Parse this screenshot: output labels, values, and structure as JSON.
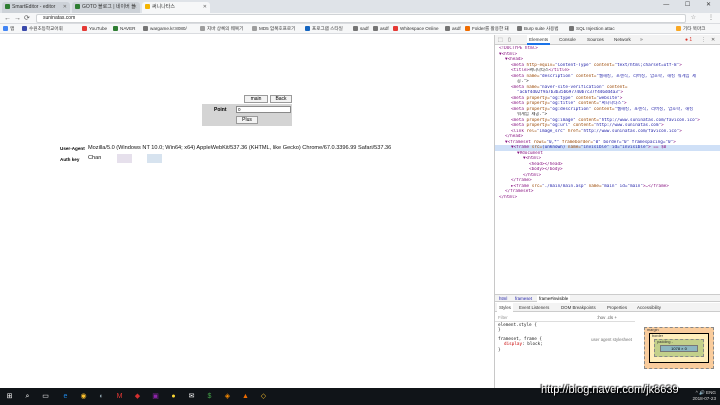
{
  "tabs": [
    {
      "label": "SmartEditor - editor",
      "color": "#2e7d32"
    },
    {
      "label": "GOTO 블로그 | 네이버 블",
      "color": "#2e7d32"
    },
    {
      "label": "써니나타스",
      "color": "#f4b400"
    }
  ],
  "window_controls": "— ☐ ✕",
  "address": {
    "back": "←",
    "forward": "→",
    "reload": "⟳",
    "url": "suninatas.com",
    "star": "☆",
    "menu": "⋮"
  },
  "bookmarks": [
    {
      "label": "앱",
      "color": "#4285f4"
    },
    {
      "label": "수원초등학교어휘",
      "color": "#3949ab"
    },
    {
      "label": "YouTube",
      "color": "#e53935"
    },
    {
      "label": "NAVER",
      "color": "#2e7d32"
    },
    {
      "label": "wargame.kr:8080/",
      "color": "#757575"
    },
    {
      "label": "지바 상록의 웨복기",
      "color": "#9e9e9e"
    },
    {
      "label": "MD5 암복호프로기",
      "color": "#9e9e9e"
    },
    {
      "label": "프로그램 스타일",
      "color": "#1565c0"
    },
    {
      "label": "sadf",
      "color": "#757575"
    },
    {
      "label": "asdf",
      "color": "#757575"
    },
    {
      "label": "Whitespace Online",
      "color": "#e53935"
    },
    {
      "label": "asdf",
      "color": "#757575"
    },
    {
      "label": "Folder를 활용한 돼",
      "color": "#ef6c00"
    },
    {
      "label": "Burp suite 사용법",
      "color": "#757575"
    },
    {
      "label": "SQL Injection attac",
      "color": "#757575"
    },
    {
      "label": "기타 북마크",
      "color": "#f9a825"
    }
  ],
  "page": {
    "main_button": "main",
    "back_button": "Back",
    "point_label": "Point",
    "point_value": "0",
    "plus_button": "Plus",
    "ua_label": "User-Agent",
    "ua_value": "Mozilla/5.0 (Windows NT 10.0; Win64; x64) AppleWebKit/537.36 (KHTML, like Gecko) Chrome/67.0.3396.99 Safari/537.36",
    "authkey_label": "Auth key",
    "authkey_value": "Chan",
    "swatch_colors": [
      "#e6e0ec",
      "#ffffff",
      "#d7e3ef"
    ]
  },
  "devtools": {
    "tabs": [
      "Elements",
      "Console",
      "Sources",
      "Network"
    ],
    "active_tab": "Elements",
    "more": "»",
    "errors": "● 1",
    "settings": "⋮",
    "close": "✕",
    "dom_lines": [
      {
        "i": 0,
        "tag": "<!DOCTYPE html>"
      },
      {
        "i": 0,
        "tag": "▼<html>"
      },
      {
        "i": 1,
        "tag": "▼<head>"
      },
      {
        "i": 2,
        "tag": "<meta",
        "attr": " http-equiv=",
        "val": "\"Content-Type\"",
        "attr2": " content=",
        "val2": "\"text/html;charset=utf-8\"",
        "end": ">"
      },
      {
        "i": 2,
        "tag": "<title>",
        "text": "써니나타스",
        "end": "</title>"
      },
      {
        "i": 2,
        "tag": "<meta",
        "attr": " name=",
        "val": "\"description\"",
        "attr2": " content=",
        "val2": "\"웹해킹, 포렌식, 리버싱, 암호학, 해킹 워게임 제",
        "end": ""
      },
      {
        "i": 3,
        "text": "공.\">"
      },
      {
        "i": 2,
        "tag": "<meta",
        "attr": " name=",
        "val": "\"naver-site-verification\"",
        "attr2": " content=",
        "val2": "",
        "end": ""
      },
      {
        "i": 3,
        "val": "\"ac6f4d02f9a7b3b35b697740b7c37f446dd4a3\"",
        "end": ">"
      },
      {
        "i": 2,
        "tag": "<meta",
        "attr": " property=",
        "val": "\"og:type\"",
        "attr2": " content=",
        "val2": "\"website\"",
        "end": ">"
      },
      {
        "i": 2,
        "tag": "<meta",
        "attr": " property=",
        "val": "\"og:title\"",
        "attr2": " content=",
        "val2": "\"써니나타스\"",
        "end": ">"
      },
      {
        "i": 2,
        "tag": "<meta",
        "attr": " property=",
        "val": "\"og:description\"",
        "attr2": " content=",
        "val2": "\"웹해킹, 포렌식, 리버싱, 암호학, 해킹",
        "end": ""
      },
      {
        "i": 3,
        "text": "워게임 제공.\">"
      },
      {
        "i": 2,
        "tag": "<meta",
        "attr": " property=",
        "val": "\"og:image\"",
        "attr2": " content=",
        "val2": "\"http://www.suninatas.com/favicon.ico\"",
        "end": ">"
      },
      {
        "i": 2,
        "tag": "<meta",
        "attr": " property=",
        "val": "\"og:url\"",
        "attr2": " content=",
        "val2": "\"http://www.suninatas.com\"",
        "end": ">"
      },
      {
        "i": 2,
        "tag": "<link",
        "attr": " rel=",
        "val": "\"image_src\"",
        "attr2": " href=",
        "val2": "\"http://www.suninatas.com/favicon.ico\"",
        "end": ">"
      },
      {
        "i": 1,
        "tag": "</head>"
      },
      {
        "i": 1,
        "tag": "▼<frameset",
        "attr": " rows=",
        "val": "\"0,*\"",
        "attr2": " frameborder=",
        "val2": "\"0\" border=\"0\" framespacing=\"0\"",
        "end": ">"
      },
      {
        "i": 2,
        "tag": "▼<frame",
        "attr": " src=",
        "val": "(unknown)",
        "attr2": " name=",
        "val2": "\"invisible\" id=\"invisible\"",
        "end": "> == $0",
        "sel": true
      },
      {
        "i": 3,
        "tag": "▼#document"
      },
      {
        "i": 4,
        "tag": "▼<html>"
      },
      {
        "i": 5,
        "tag": "<head></head>"
      },
      {
        "i": 5,
        "tag": "<body></body>"
      },
      {
        "i": 4,
        "tag": "</html>"
      },
      {
        "i": 2,
        "tag": "</frame>"
      },
      {
        "i": 2,
        "tag": "►<frame",
        "attr": " src=",
        "val": "\"./main/main.asp\"",
        "attr2": " name=",
        "val2": "\"main\" id=\"main\"",
        "end": ">…</frame>"
      },
      {
        "i": 1,
        "tag": "</frameset>"
      },
      {
        "i": 0,
        "tag": "</html>"
      }
    ],
    "breadcrumbs": [
      "html",
      "frameset",
      "frame#invisible"
    ],
    "sub_tabs": [
      "Styles",
      "Event Listeners",
      "DOM Breakpoints",
      "Properties",
      "Accessibility"
    ],
    "active_sub_tab": "Styles",
    "filter_placeholder": "Filter",
    "filter_opts": ":hov  .cls  +",
    "styles": {
      "element_style": "element.style {",
      "close_brace": "}",
      "rule_selector": "frameset, frame {",
      "rule_source": "user agent stylesheet",
      "rule_prop": "display",
      "rule_value": "block;"
    },
    "boxmodel": {
      "margin": "margin",
      "border": "border",
      "padding": "padding -",
      "content": "1078 × 0",
      "dash": "-"
    },
    "computed": {
      "filter": "Filter",
      "show_all": "Show all",
      "prop1": "display",
      "val1": "block",
      "prop2": "height",
      "val2": "0px"
    }
  },
  "taskbar": {
    "icons": [
      "⊞",
      "⌕",
      "▭",
      "e",
      "◉",
      "◐",
      "M",
      "◆",
      "▣",
      "●",
      "✉",
      "$",
      "◈",
      "▲",
      "◇"
    ],
    "tray": "^ 🔊 ENG",
    "date": "2018-07-23"
  },
  "watermark": "http://blog.naver.com/jk8639"
}
